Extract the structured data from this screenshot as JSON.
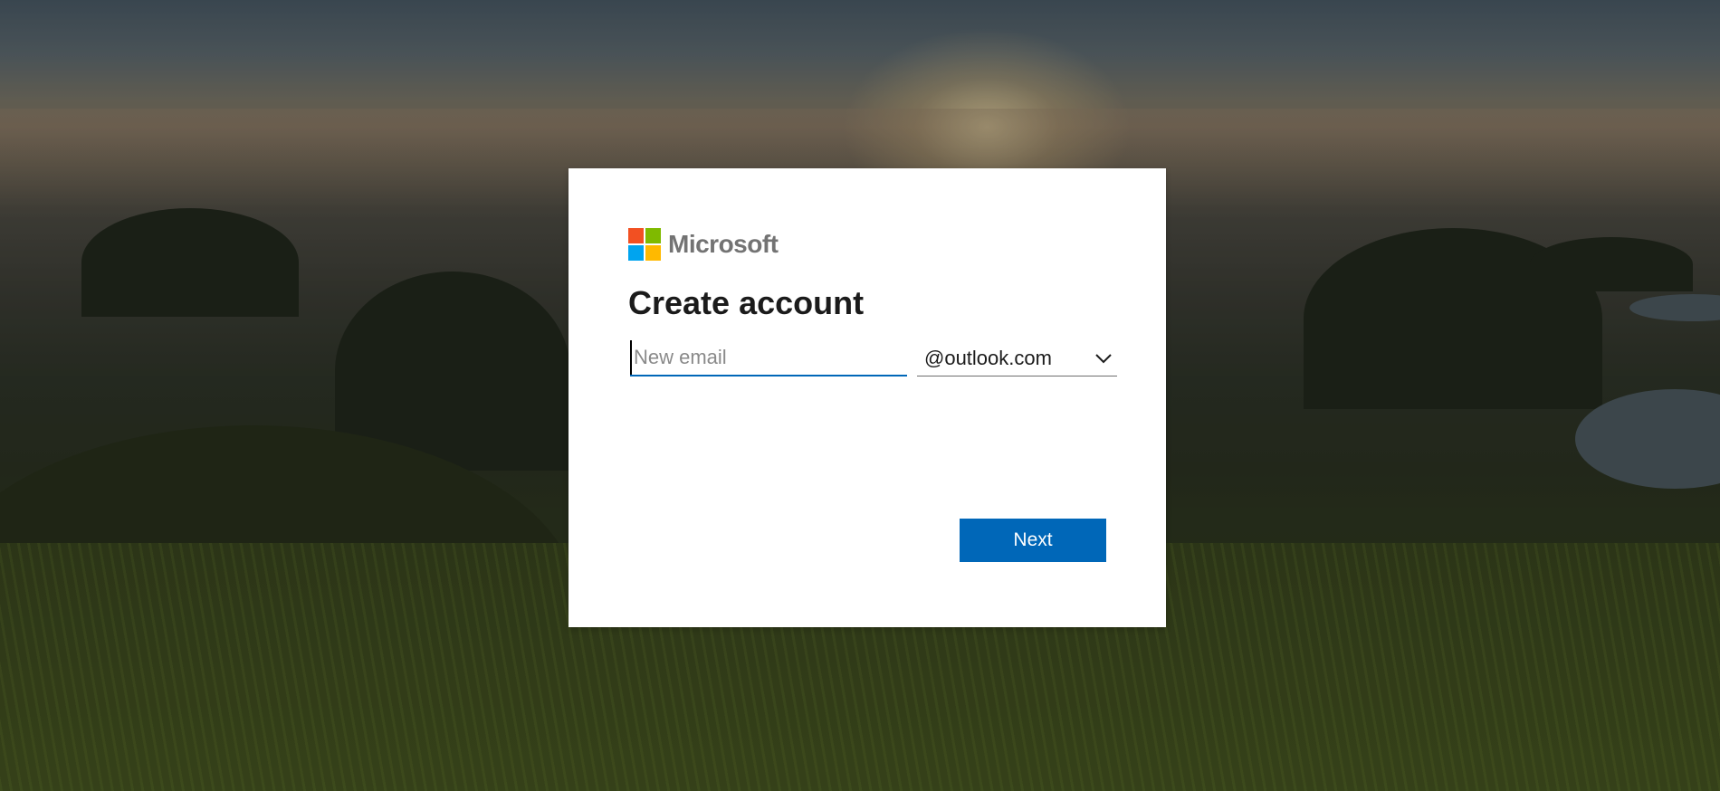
{
  "brand": {
    "name": "Microsoft",
    "logo_colors": [
      "#f25022",
      "#7fba00",
      "#00a4ef",
      "#ffb900"
    ]
  },
  "form": {
    "title": "Create account",
    "email_placeholder": "New email",
    "email_value": "",
    "domain_selected": "@outlook.com",
    "next_label": "Next"
  },
  "colors": {
    "accent": "#0067b8",
    "card_background": "#ffffff"
  }
}
